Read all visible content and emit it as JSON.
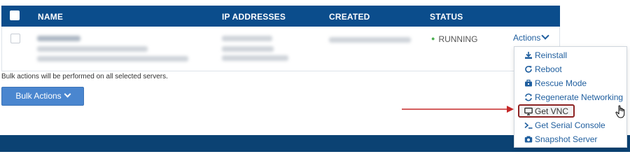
{
  "table": {
    "headers": {
      "name": "NAME",
      "ip": "IP ADDRESSES",
      "created": "CREATED",
      "status": "STATUS"
    },
    "row": {
      "status": "RUNNING",
      "actions_label": "Actions"
    }
  },
  "bulk": {
    "note": "Bulk actions will be performed on all selected servers.",
    "button_label": "Bulk Actions"
  },
  "menu": {
    "items": [
      {
        "label": "Reinstall",
        "icon": "download-icon"
      },
      {
        "label": "Reboot",
        "icon": "refresh-icon"
      },
      {
        "label": "Rescue Mode",
        "icon": "briefcase-icon"
      },
      {
        "label": "Regenerate Networking",
        "icon": "sync-icon"
      },
      {
        "label": "Get VNC",
        "icon": "monitor-icon"
      },
      {
        "label": "Get Serial Console",
        "icon": "terminal-icon"
      },
      {
        "label": "Snapshot Server",
        "icon": "camera-icon"
      }
    ]
  },
  "colors": {
    "header_bg": "#0b4d8c",
    "link": "#1f5e9e",
    "button_bg": "#4a86cf",
    "annotation_arrow": "#c62828",
    "highlight_border": "#8e2323",
    "status_dot": "#4caf50"
  }
}
